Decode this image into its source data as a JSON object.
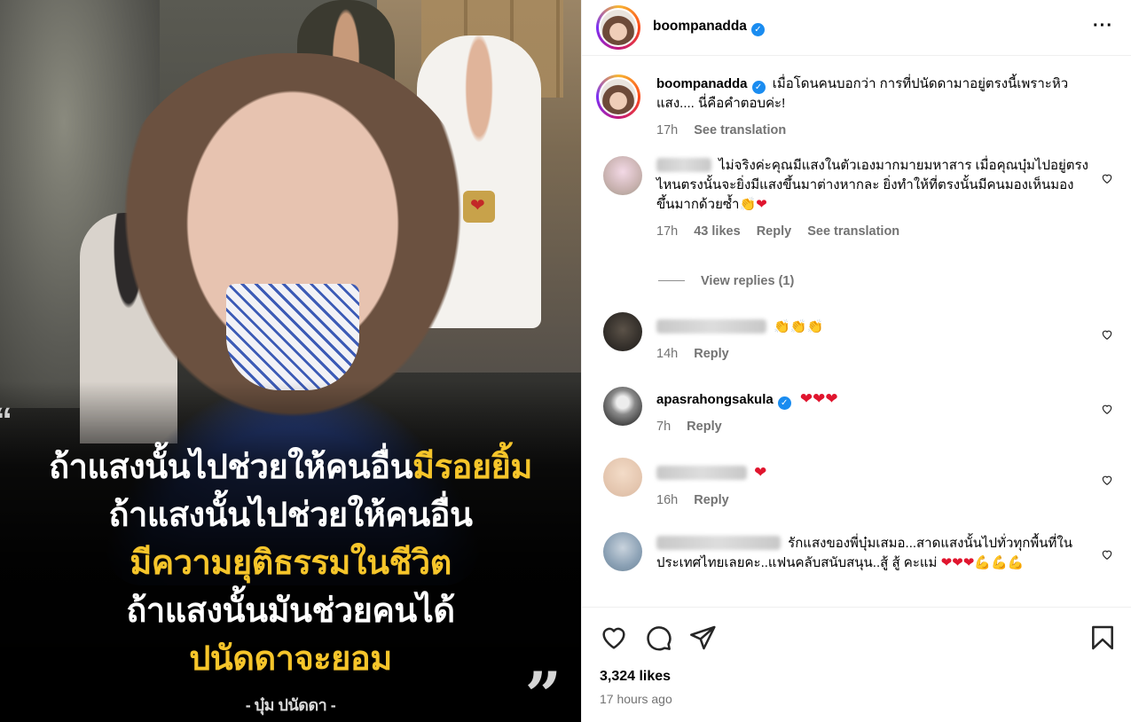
{
  "post_image": {
    "caption_lines": [
      {
        "white": "ถ้าแสงนั้นไปช่วยให้คนอื่น",
        "yellow": "มีรอยยิ้ม"
      },
      {
        "white": "ถ้าแสงนั้นไปช่วยให้คนอื่น",
        "yellow": ""
      },
      {
        "white": "",
        "yellow": "มีความยุติธรรมในชีวิต"
      },
      {
        "white": "ถ้าแสงนั้นมันช่วยคนได้",
        "yellow": ""
      },
      {
        "white": "",
        "yellow": "ปนัดดาจะยอม"
      }
    ],
    "signature": "- บุ๋ม ปนัดดา -"
  },
  "header": {
    "username": "boompanadda",
    "more_icon": "more-horizontal-icon"
  },
  "caption_post": {
    "username": "boompanadda",
    "text": "เมื่อโดนคนบอกว่า การที่ปนัดดามาอยู่ตรงนี้เพราะหิวแสง.... นี่คือคำตอบค่ะ!",
    "time": "17h",
    "see_translation": "See translation"
  },
  "comments": [
    {
      "username": "",
      "text": "ไม่จริงค่ะคุณมีแสงในตัวเองมากมายมหาสาร เมื่อคุณบุ๋มไปอยู่ตรงไหนตรงนั้นจะยิ่งมีแสงขึ้นมาต่างหากละ ยิ่งทำให้ที่ตรงนั้นมีคนมองเห็นมองขึ้นมากด้วยซ้ำ",
      "emoji": "👏❤",
      "time": "17h",
      "likes": "43 likes",
      "reply": "Reply",
      "see_translation": "See translation",
      "view_replies": "View replies (1)"
    },
    {
      "username": "",
      "text": "",
      "emoji": "👏👏👏",
      "time": "14h",
      "reply": "Reply"
    },
    {
      "username": "apasrahongsakula",
      "text": "",
      "emoji": "❤❤❤",
      "time": "7h",
      "reply": "Reply"
    },
    {
      "username": "",
      "text": "",
      "emoji": "❤",
      "time": "16h",
      "reply": "Reply"
    },
    {
      "username": "",
      "text": "รักแสงของพี่บุ๋มเสมอ...สาดแสงนั้นไปทั่วทุกพื้นที่ในประเทศไทยเลยคะ..แฟนคลับสนับสนุน..สู้ สู้ คะแม่",
      "emoji": "❤❤❤💪💪💪",
      "time": "",
      "reply": ""
    }
  ],
  "footer": {
    "likes": "3,324 likes",
    "time": "17 hours ago"
  },
  "colors": {
    "accent_yellow": "#f6c52a",
    "verified_blue": "#1a8cf0",
    "heart_red": "#e0152e",
    "meta_gray": "#737373"
  }
}
